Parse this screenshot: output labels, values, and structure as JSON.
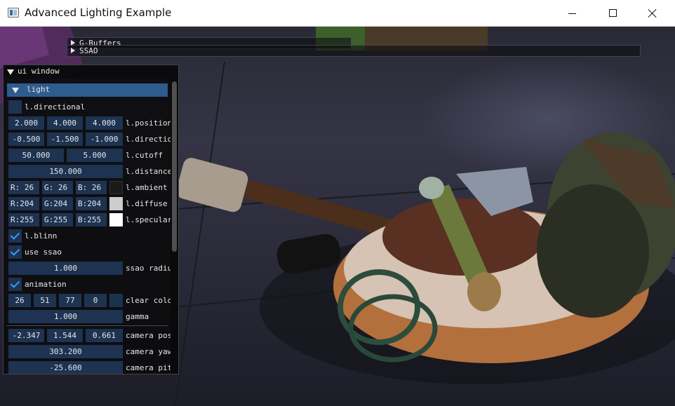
{
  "window": {
    "title": "Advanced Lighting Example",
    "controls": [
      "minimize",
      "maximize",
      "close"
    ]
  },
  "collapsed_windows": [
    {
      "label": "G-Buffers"
    },
    {
      "label": "SSAO"
    }
  ],
  "ui_window": {
    "title": "ui window",
    "header": "light",
    "directional_label": "l.directional",
    "position": {
      "values": [
        "2.000",
        "4.000",
        "4.000"
      ],
      "label": "l.position"
    },
    "direction": {
      "values": [
        "-0.500",
        "-1.500",
        "-1.000"
      ],
      "label": "l.direction"
    },
    "cutoff": {
      "values": [
        "50.000",
        "5.000"
      ],
      "label": "l.cutoff"
    },
    "distance": {
      "value": "150.000",
      "label": "l.distance"
    },
    "ambient": {
      "values": [
        "R: 26",
        "G: 26",
        "B: 26"
      ],
      "label": "l.ambient",
      "color": "#1a1a1a"
    },
    "diffuse": {
      "values": [
        "R:204",
        "G:204",
        "B:204"
      ],
      "label": "l.diffuse",
      "color": "#cccccc"
    },
    "specular": {
      "values": [
        "R:255",
        "G:255",
        "B:255"
      ],
      "label": "l.specular",
      "color": "#ffffff"
    },
    "blinn": {
      "label": "l.blinn",
      "checked": true
    },
    "use_ssao": {
      "label": "use ssao",
      "checked": true
    },
    "ssao_radius": {
      "value": "1.000",
      "label": "ssao radius"
    },
    "animation": {
      "label": "animation",
      "checked": true
    },
    "clear_color": {
      "values": [
        "26",
        "51",
        "77",
        "0"
      ],
      "label": "clear color",
      "color": "#1a334d"
    },
    "gamma": {
      "value": "1.000",
      "label": "gamma"
    },
    "camera_position": {
      "values": [
        "-2.347",
        "1.544",
        "0.661"
      ],
      "label": "camera position"
    },
    "camera_yaw": {
      "value": "303.200",
      "label": "camera yaw"
    },
    "camera_pitch": {
      "value": "-25.600",
      "label": "camera pitch"
    }
  },
  "theme": {
    "frame_bg": "#1d3351",
    "header_bg": "#2e5c8f",
    "check_mark": "#4296fa",
    "window_bg": "#0c0c0e"
  }
}
